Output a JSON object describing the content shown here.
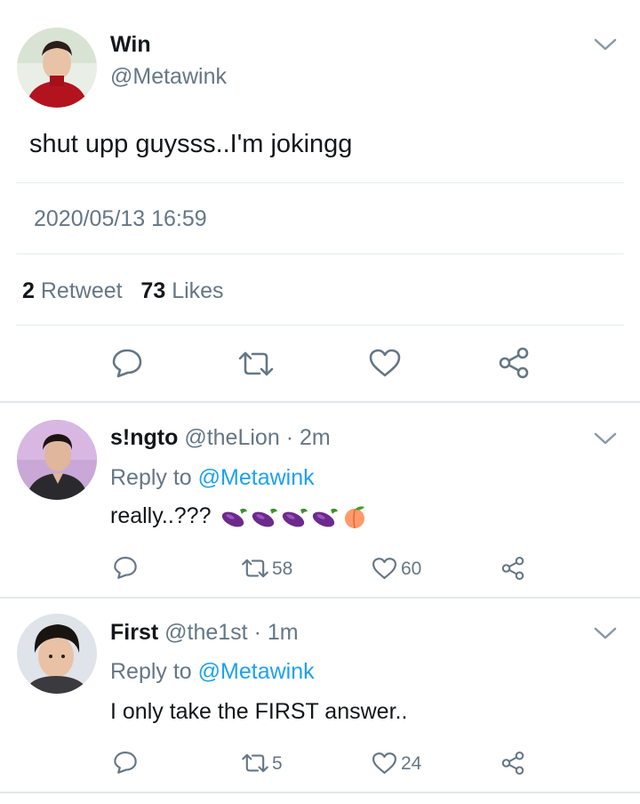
{
  "main_tweet": {
    "name": "Win",
    "handle": "@Metawink",
    "text": "shut upp guysss..I'm jokingg",
    "timestamp": "2020/05/13 16:59",
    "retweet_count": "2",
    "retweet_label": "Retweet",
    "likes_count": "73",
    "likes_label": "Likes",
    "avatar": "person-red-turtleneck"
  },
  "replies": [
    {
      "name": "s!ngto",
      "handle": "@theLion",
      "time": "· 2m",
      "reply_to_label": "Reply to",
      "reply_to_mention": "@Metawink",
      "text": "really..???",
      "emojis": [
        "eggplant",
        "eggplant",
        "eggplant",
        "eggplant",
        "peach"
      ],
      "retweets": "58",
      "likes": "60",
      "avatar": "person-dark-jacket-purple-bg"
    },
    {
      "name": "First",
      "handle": "@the1st",
      "time": "· 1m",
      "reply_to_label": "Reply to",
      "reply_to_mention": "@Metawink",
      "text": "I only take the FIRST answer..",
      "retweets": "5",
      "likes": "24",
      "avatar": "person-dark-hair"
    }
  ],
  "colors": {
    "text": "#14171a",
    "secondary": "#657786",
    "link": "#1da1f2",
    "divider": "#e6ecf0"
  }
}
